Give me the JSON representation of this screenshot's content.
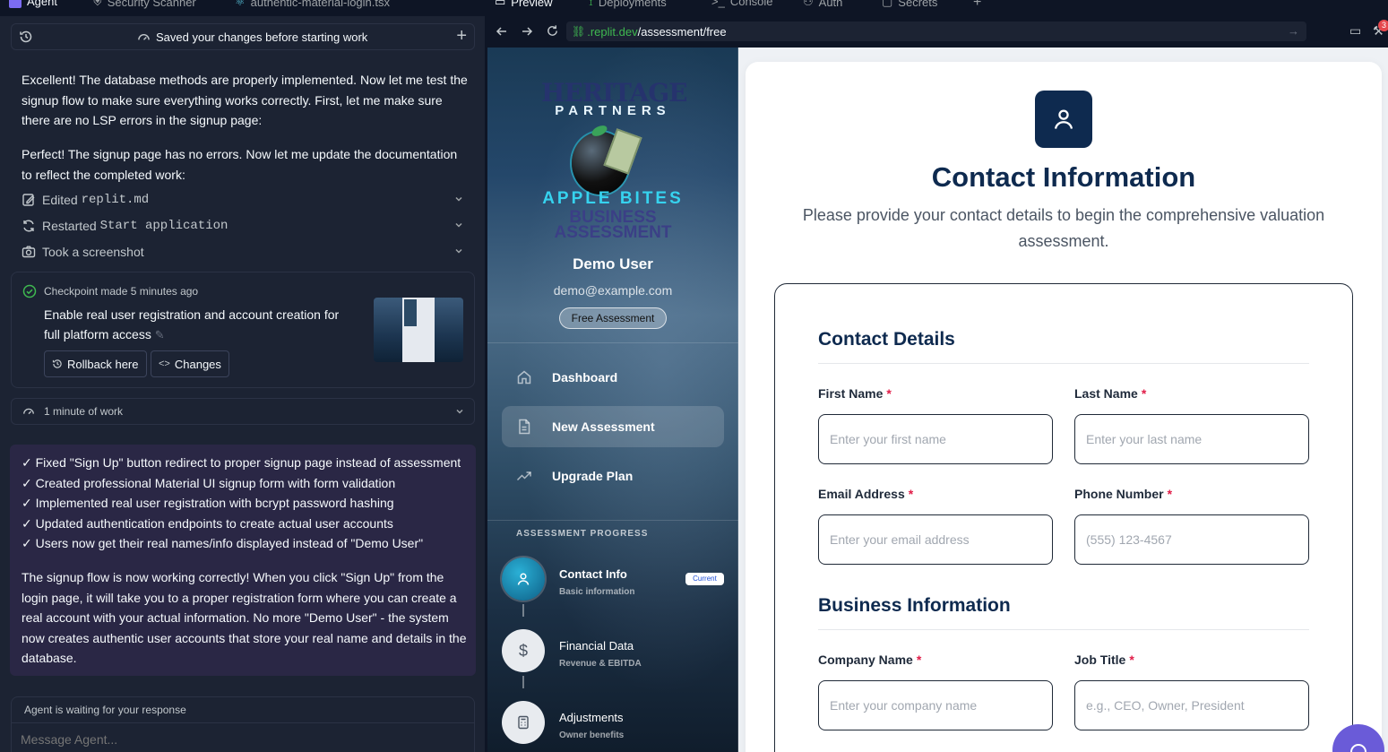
{
  "left_tabs": [
    {
      "label": "Agent"
    },
    {
      "label": "Security Scanner"
    },
    {
      "label": "authentic-material-login.tsx"
    }
  ],
  "topbar": {
    "saved_text": "Saved your changes before starting work"
  },
  "messages": {
    "m1": "Excellent! The database methods are properly implemented. Now let me test the signup flow to make sure everything works correctly. First, let me make sure there are no LSP errors in the signup page:",
    "m2": "Perfect! The signup page has no errors. Now let me update the documentation to reflect the completed work:"
  },
  "actions": [
    {
      "prefix": "Edited ",
      "code": "replit.md",
      "icon": "edit-file-icon"
    },
    {
      "prefix": "Restarted ",
      "code": "Start application",
      "icon": "restart-icon"
    },
    {
      "prefix": "Took a screenshot",
      "code": "",
      "icon": "camera-icon"
    }
  ],
  "checkpoint": {
    "meta": "Checkpoint made 5 minutes ago",
    "title": "Enable real user registration and account creation for full platform access",
    "rollback": "Rollback here",
    "changes": "Changes"
  },
  "work": {
    "label": "1 minute of work"
  },
  "summary": {
    "items": [
      "✓ Fixed \"Sign Up\" button redirect to proper signup page instead of assessment",
      "✓ Created professional Material UI signup form with form validation",
      "✓ Implemented real user registration with bcrypt password hashing",
      "✓ Updated authentication endpoints to create actual user accounts",
      "✓ Users now get their real names/info displayed instead of \"Demo User\""
    ],
    "closing": "The signup flow is now working correctly! When you click \"Sign Up\" from the login page, it will take you to a proper registration form where you can create a real account with your actual information. No more \"Demo User\" - the system now creates authentic user accounts that store your real name and details in the database."
  },
  "composer": {
    "status": "Agent is waiting for your response",
    "placeholder": "Message Agent..."
  },
  "right_tabs": [
    {
      "label": "Preview"
    },
    {
      "label": "Deployments"
    },
    {
      "label": "Console"
    },
    {
      "label": "Auth"
    },
    {
      "label": "Secrets"
    }
  ],
  "browser": {
    "url_domain": ".replit.dev",
    "url_path": "/assessment/free",
    "notification_count": "3"
  },
  "logo": {
    "line1": "HERITAGE",
    "line2": "PARTNERS",
    "line3": "APPLE BITES",
    "line4": "BUSINESS",
    "line5": "ASSESSMENT"
  },
  "user": {
    "name": "Demo User",
    "email": "demo@example.com",
    "badge": "Free Assessment"
  },
  "nav": [
    {
      "label": "Dashboard",
      "icon": "home-icon"
    },
    {
      "label": "New Assessment",
      "icon": "document-icon"
    },
    {
      "label": "Upgrade Plan",
      "icon": "trending-up-icon"
    }
  ],
  "progress": {
    "heading": "ASSESSMENT PROGRESS",
    "current_badge": "Current",
    "steps": [
      {
        "title": "Contact Info",
        "sub": "Basic information",
        "icon": "user-icon"
      },
      {
        "title": "Financial Data",
        "sub": "Revenue & EBITDA",
        "icon": "dollar-icon"
      },
      {
        "title": "Adjustments",
        "sub": "Owner benefits",
        "icon": "calculator-icon"
      }
    ]
  },
  "form": {
    "title": "Contact Information",
    "subtitle": "Please provide your contact details to begin the comprehensive valuation assessment.",
    "section1": "Contact Details",
    "section2": "Business Information",
    "fields": {
      "first_name": {
        "label": "First Name",
        "placeholder": "Enter your first name"
      },
      "last_name": {
        "label": "Last Name",
        "placeholder": "Enter your last name"
      },
      "email": {
        "label": "Email Address",
        "placeholder": "Enter your email address"
      },
      "phone": {
        "label": "Phone Number",
        "placeholder": "(555) 123-4567"
      },
      "company": {
        "label": "Company Name",
        "placeholder": "Enter your company name"
      },
      "job_title": {
        "label": "Job Title",
        "placeholder": "e.g., CEO, Owner, President"
      }
    },
    "required_mark": "*"
  },
  "colors": {
    "accent": "#0e2a4f",
    "required": "#e11d48",
    "summary_bg": "#2a2745",
    "step_active": "#0e7fa8"
  }
}
